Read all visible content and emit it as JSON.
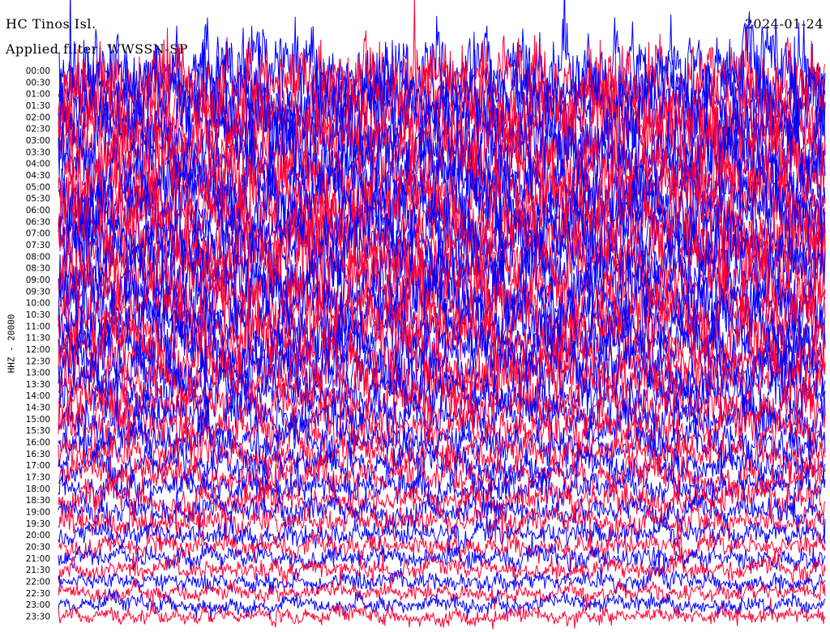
{
  "header": {
    "station": "HC Tinos Isl.",
    "date": "2024-01-24",
    "filter": "Applied filter: WWSSN-SP",
    "channel": "HHZ - 20000"
  },
  "colors": {
    "trace_a": "#0000ff",
    "trace_b": "#ff0033",
    "background": "#ffffff"
  },
  "chart_data": {
    "type": "line",
    "title": "HC Tinos Isl.",
    "subtitle": "Applied filter: WWSSN-SP",
    "ylabel": "HHZ - 20000",
    "xlabel": "",
    "grid": false,
    "legend": "none",
    "row_interval_minutes": 30,
    "row_labels": [
      "00:00",
      "00:30",
      "01:00",
      "01:30",
      "02:00",
      "02:30",
      "03:00",
      "03:30",
      "04:00",
      "04:30",
      "05:00",
      "05:30",
      "06:00",
      "06:30",
      "07:00",
      "07:30",
      "08:00",
      "08:30",
      "09:00",
      "09:30",
      "10:00",
      "10:30",
      "11:00",
      "11:30",
      "12:00",
      "12:30",
      "13:00",
      "13:30",
      "14:00",
      "14:30",
      "15:00",
      "15:30",
      "16:00",
      "16:30",
      "17:00",
      "17:30",
      "18:00",
      "18:30",
      "19:00",
      "19:30",
      "20:00",
      "20:30",
      "21:00",
      "21:30",
      "22:00",
      "22:30",
      "23:00",
      "23:30"
    ],
    "row_colors": [
      "#0000ff",
      "#ff0033"
    ],
    "relative_amplitude": [
      3.2,
      3.2,
      3.1,
      3.1,
      3.1,
      3.0,
      3.0,
      3.0,
      3.0,
      3.0,
      2.9,
      2.9,
      2.9,
      2.9,
      2.9,
      2.9,
      2.8,
      2.8,
      2.8,
      2.8,
      2.7,
      2.7,
      2.6,
      2.6,
      2.5,
      2.4,
      2.3,
      2.2,
      2.0,
      1.9,
      1.8,
      1.7,
      1.6,
      1.5,
      1.45,
      1.4,
      1.35,
      1.3,
      1.2,
      1.1,
      1.0,
      0.95,
      0.9,
      0.85,
      0.8,
      0.75,
      0.72,
      0.7
    ]
  }
}
